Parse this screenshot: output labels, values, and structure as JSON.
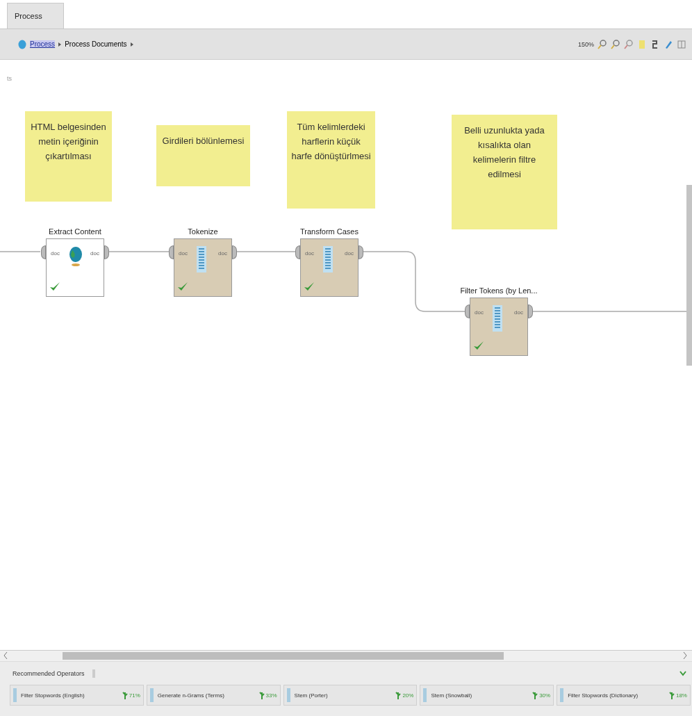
{
  "tabs": [
    {
      "label": "Process",
      "selected": true
    }
  ],
  "breadcrumb": {
    "items": [
      {
        "label": "Process",
        "kind": "link"
      },
      {
        "label": "Process Documents",
        "kind": "text"
      }
    ]
  },
  "toolbar": {
    "zoom": "150%"
  },
  "canvas": {
    "corner_text": "ts",
    "notes": [
      {
        "text": "HTML belgesinden metin içeriğinin çıkartılması"
      },
      {
        "text": "Girdileri bölünlemesi"
      },
      {
        "text": "Tüm kelimlerdeki harflerin küçük harfe dönüştürlmesi"
      },
      {
        "text": "Belli uzunlukta yada kısalıkta olan kelimelerin filtre edilmesi"
      }
    ],
    "operators": [
      {
        "name": "Extract Content",
        "kind": "web",
        "in_port": "doc",
        "out_port": "doc",
        "executed": true
      },
      {
        "name": "Tokenize",
        "kind": "text",
        "in_port": "doc",
        "out_port": "doc",
        "executed": true
      },
      {
        "name": "Transform Cases",
        "kind": "text",
        "in_port": "doc",
        "out_port": "doc",
        "executed": true
      },
      {
        "name": "Filter Tokens (by Len...",
        "kind": "text",
        "in_port": "doc",
        "out_port": "doc",
        "executed": true
      }
    ]
  },
  "recommended": {
    "title": "Recommended Operators",
    "items": [
      {
        "name": "Filter Stopwords (English)",
        "share": "71%"
      },
      {
        "name": "Generate n-Grams (Terms)",
        "share": "33%"
      },
      {
        "name": "Stem (Porter)",
        "share": "20%"
      },
      {
        "name": "Stem (Snowball)",
        "share": "30%"
      },
      {
        "name": "Filter Stopwords (Dictionary)",
        "share": "18%"
      }
    ]
  }
}
